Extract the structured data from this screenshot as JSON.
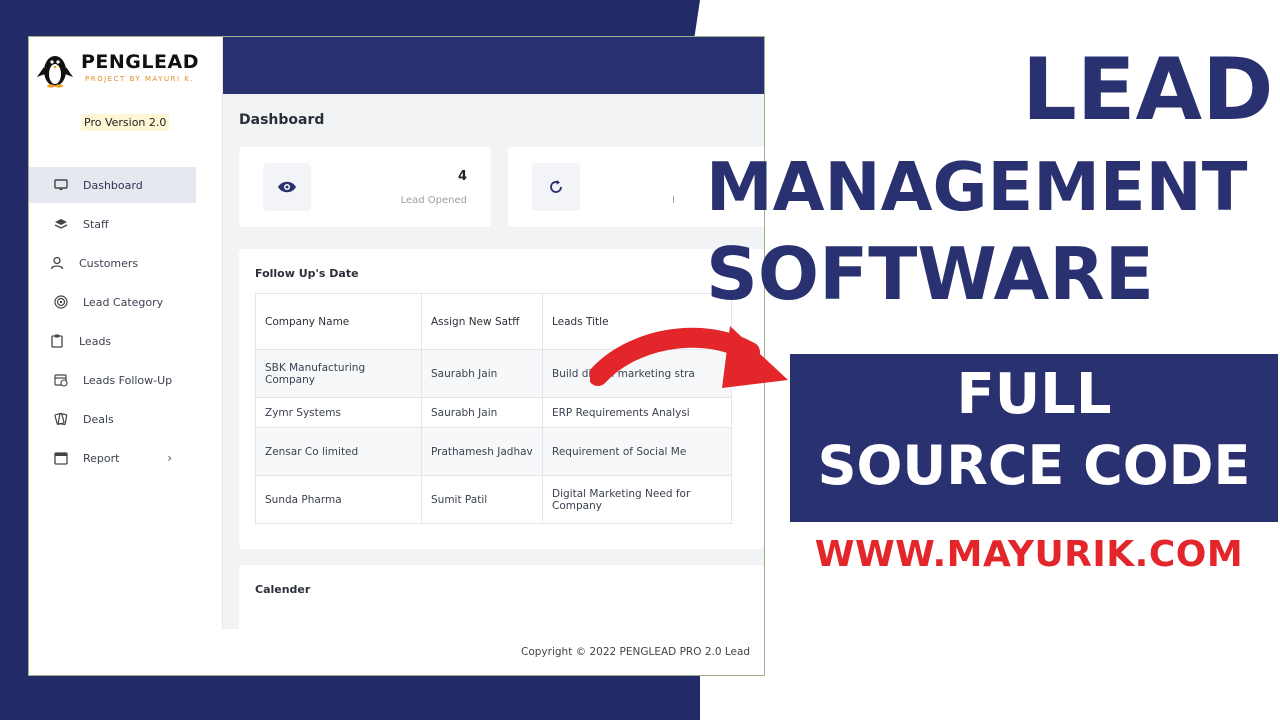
{
  "app": {
    "logo_name": "PENGLEAD",
    "logo_sub": "PROJECT BY MAYURI K.",
    "version": "Pro Version 2.0",
    "page_title": "Dashboard",
    "sidebar": {
      "items": [
        {
          "label": "Dashboard",
          "icon": "monitor-icon"
        },
        {
          "label": "Staff",
          "icon": "layers-icon"
        },
        {
          "label": "Customers",
          "icon": "user-icon"
        },
        {
          "label": "Lead Category",
          "icon": "target-icon"
        },
        {
          "label": "Leads",
          "icon": "clipboard-icon"
        },
        {
          "label": "Leads Follow-Up",
          "icon": "calendar-clock-icon"
        },
        {
          "label": "Deals",
          "icon": "cards-icon"
        },
        {
          "label": "Report",
          "icon": "calendar-icon"
        }
      ]
    },
    "stats": [
      {
        "value": "4",
        "label": "Lead Opened",
        "icon": "eye-icon"
      },
      {
        "value": "",
        "label": "I",
        "icon": "refresh-icon"
      }
    ],
    "followups": {
      "title": "Follow Up's Date",
      "columns": [
        "Company Name",
        "Assign New Satff",
        "Leads Title"
      ],
      "rows": [
        [
          "SBK Manufacturing Company",
          "Saurabh Jain",
          "Build digital marketing stra"
        ],
        [
          "Zymr Systems",
          "Saurabh Jain",
          "ERP Requirements Analysi"
        ],
        [
          "Zensar Co limited",
          "Prathamesh Jadhav",
          "Requirement of Social Me"
        ],
        [
          "Sunda Pharma",
          "Sumit Patil",
          "Digital Marketing Need for Company"
        ]
      ]
    },
    "calendar_title": "Calender",
    "footer": "Copyright © 2022 PENGLEAD PRO 2.0 Lead"
  },
  "promo": {
    "line1": "LEAD",
    "line2": "MANAGEMENT",
    "line3": "SOFTWARE",
    "box_line1": "FULL",
    "box_line2": "SOURCE CODE",
    "url": "WWW.MAYURIK.COM",
    "colors": {
      "navy": "#2a3170",
      "red": "#e3262a"
    }
  }
}
